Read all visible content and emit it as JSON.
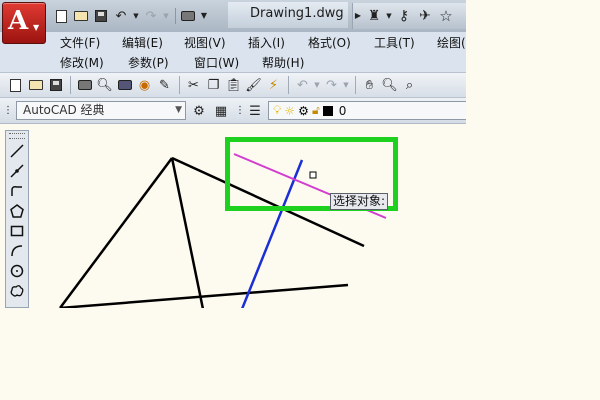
{
  "titlebar": {
    "doc_title": "Drawing1.dwg",
    "logo_letter": "A",
    "quick_access_icons": [
      "new-doc-icon",
      "open-folder-icon",
      "save-icon",
      "undo-icon",
      "redo-icon",
      "print-icon"
    ],
    "search_icons": [
      "binoculars-icon",
      "key-icon",
      "satellite-icon",
      "star-icon"
    ]
  },
  "menubar": {
    "row1": [
      "文件(F)",
      "编辑(E)",
      "视图(V)",
      "插入(I)",
      "格式(O)",
      "工具(T)",
      "绘图("
    ],
    "row2": [
      "修改(M)",
      "参数(P)",
      "窗口(W)",
      "帮助(H)"
    ]
  },
  "toolbar2": {
    "workspace": "AutoCAD 经典",
    "layer_value": "0"
  },
  "canvas": {
    "tooltip": "选择对象:",
    "colors": {
      "black_lines": "#000000",
      "blue_line": "#1b2fd6",
      "magenta_line": "#d23ed0",
      "highlight": "#1fd11f"
    }
  }
}
